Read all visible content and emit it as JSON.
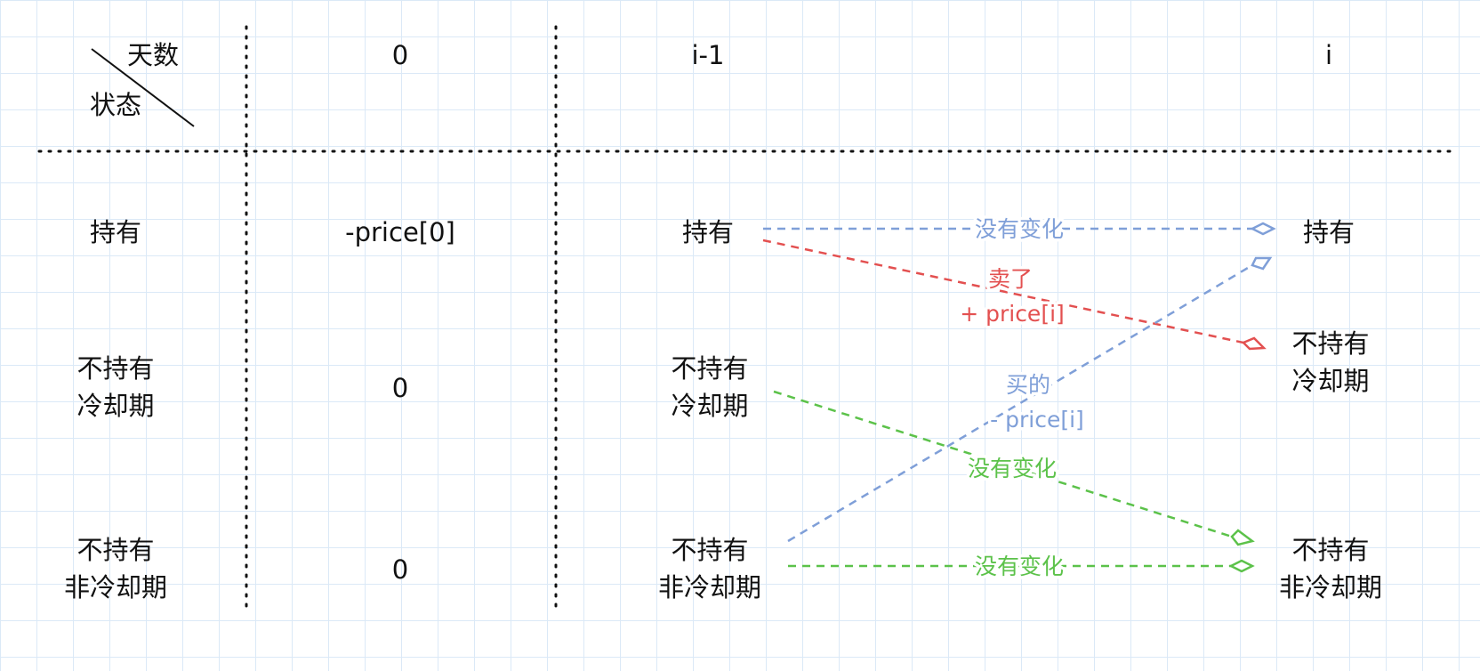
{
  "header": {
    "days_label": "天数",
    "state_label": "状态",
    "day0": "0",
    "day_prev": "i-1",
    "day_cur": "i"
  },
  "rows": {
    "hold": "持有",
    "cooldown_1": "不持有",
    "cooldown_2": "冷却期",
    "noncool_1": "不持有",
    "noncool_2": "非冷却期"
  },
  "day0_values": {
    "hold": "-price[0]",
    "cooldown": "0",
    "noncool": "0"
  },
  "transitions": {
    "hold_no_change": "没有变化",
    "sell_1": "卖了",
    "sell_2": "+ price[i]",
    "buy_1": "买的",
    "buy_2": "- price[i]",
    "cool_to_noncool": "没有变化",
    "noncool_no_change": "没有变化"
  },
  "colors": {
    "blue": "#7f9fd8",
    "red": "#e35050",
    "green": "#5cc24a"
  }
}
